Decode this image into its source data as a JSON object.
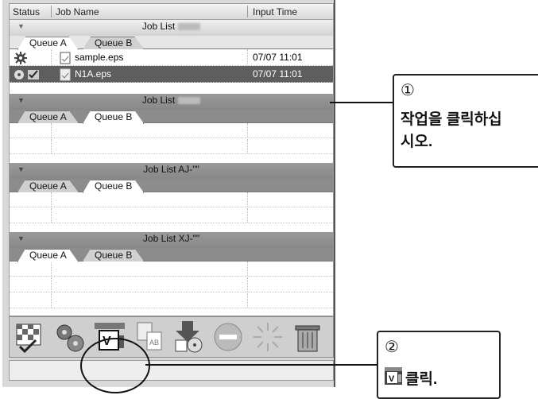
{
  "header": {
    "status": "Status",
    "job_name": "Job Name",
    "input_time": "Input Time"
  },
  "joblists": [
    {
      "title": "Job List",
      "tabs": [
        "Queue A",
        "Queue B"
      ],
      "active_tab": "Queue A",
      "rows": [
        {
          "name": "sample.eps",
          "time": "07/07 11:01",
          "selected": false
        },
        {
          "name": "N1A.eps",
          "time": "07/07 11:01",
          "selected": true
        }
      ]
    },
    {
      "title": "Job List",
      "tabs": [
        "Queue A",
        "Queue B"
      ],
      "active_tab": "Queue B"
    },
    {
      "title": "Job List AJ-\"\"",
      "tabs": [
        "Queue A",
        "Queue B"
      ],
      "active_tab": "Queue B"
    },
    {
      "title": "Job List XJ-\"\"",
      "tabs": [
        "Queue A",
        "Queue B"
      ],
      "active_tab": "Queue A"
    }
  ],
  "toolbar": {
    "icons": [
      "checkered-flag-icon",
      "gears-icon",
      "print-verify-icon",
      "copy-files-icon",
      "download-disk-icon",
      "stop-icon",
      "starburst-icon",
      "trash-icon"
    ]
  },
  "callouts": {
    "one": {
      "number": "①",
      "text_line1": "작업을 클릭하십",
      "text_line2": "시오."
    },
    "two": {
      "number": "②",
      "text": "클릭."
    }
  }
}
